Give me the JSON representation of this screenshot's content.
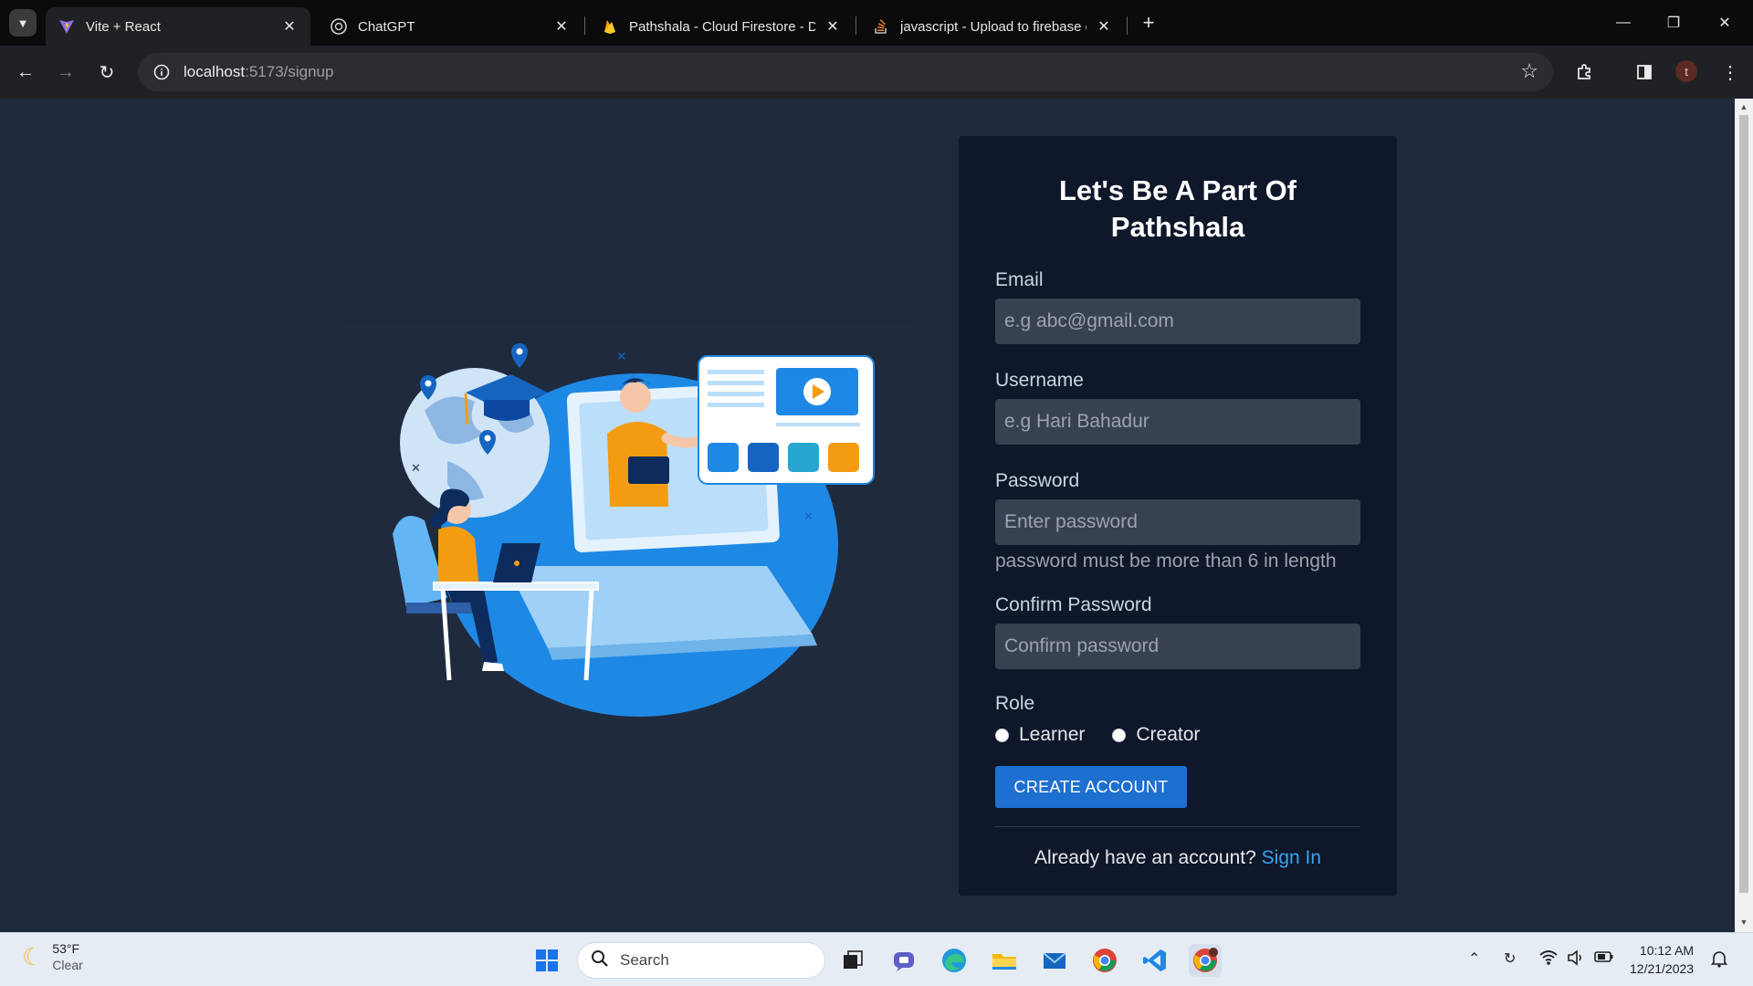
{
  "browser": {
    "tabs": [
      {
        "title": "Vite + React",
        "icon": "vite-icon",
        "active": true
      },
      {
        "title": "ChatGPT",
        "icon": "chatgpt-icon",
        "active": false
      },
      {
        "title": "Pathshala - Cloud Firestore - Da",
        "icon": "firebase-icon",
        "active": false
      },
      {
        "title": "javascript - Upload to firebase e",
        "icon": "stackoverflow-icon",
        "active": false
      }
    ],
    "url_host": "localhost",
    "url_path": ":5173/signup",
    "profile_initial": "t"
  },
  "signup": {
    "title": "Let's Be A Part Of Pathshala",
    "email_label": "Email",
    "email_placeholder": "e.g abc@gmail.com",
    "username_label": "Username",
    "username_placeholder": "e.g Hari Bahadur",
    "password_label": "Password",
    "password_placeholder": "Enter password",
    "password_hint": "password must be more than 6 in length",
    "confirm_label": "Confirm Password",
    "confirm_placeholder": "Confirm password",
    "role_label": "Role",
    "role_options": [
      "Learner",
      "Creator"
    ],
    "submit_label": "CREATE ACCOUNT",
    "signin_prompt": "Already have an account?",
    "signin_link": "Sign In"
  },
  "taskbar": {
    "weather_temp": "53°F",
    "weather_cond": "Clear",
    "search_placeholder": "Search",
    "time": "10:12 AM",
    "date": "12/21/2023"
  },
  "colors": {
    "page_bg": "#1e293b",
    "card_bg": "#0f172a",
    "primary": "#1d6fd0",
    "link": "#38a3f1"
  }
}
